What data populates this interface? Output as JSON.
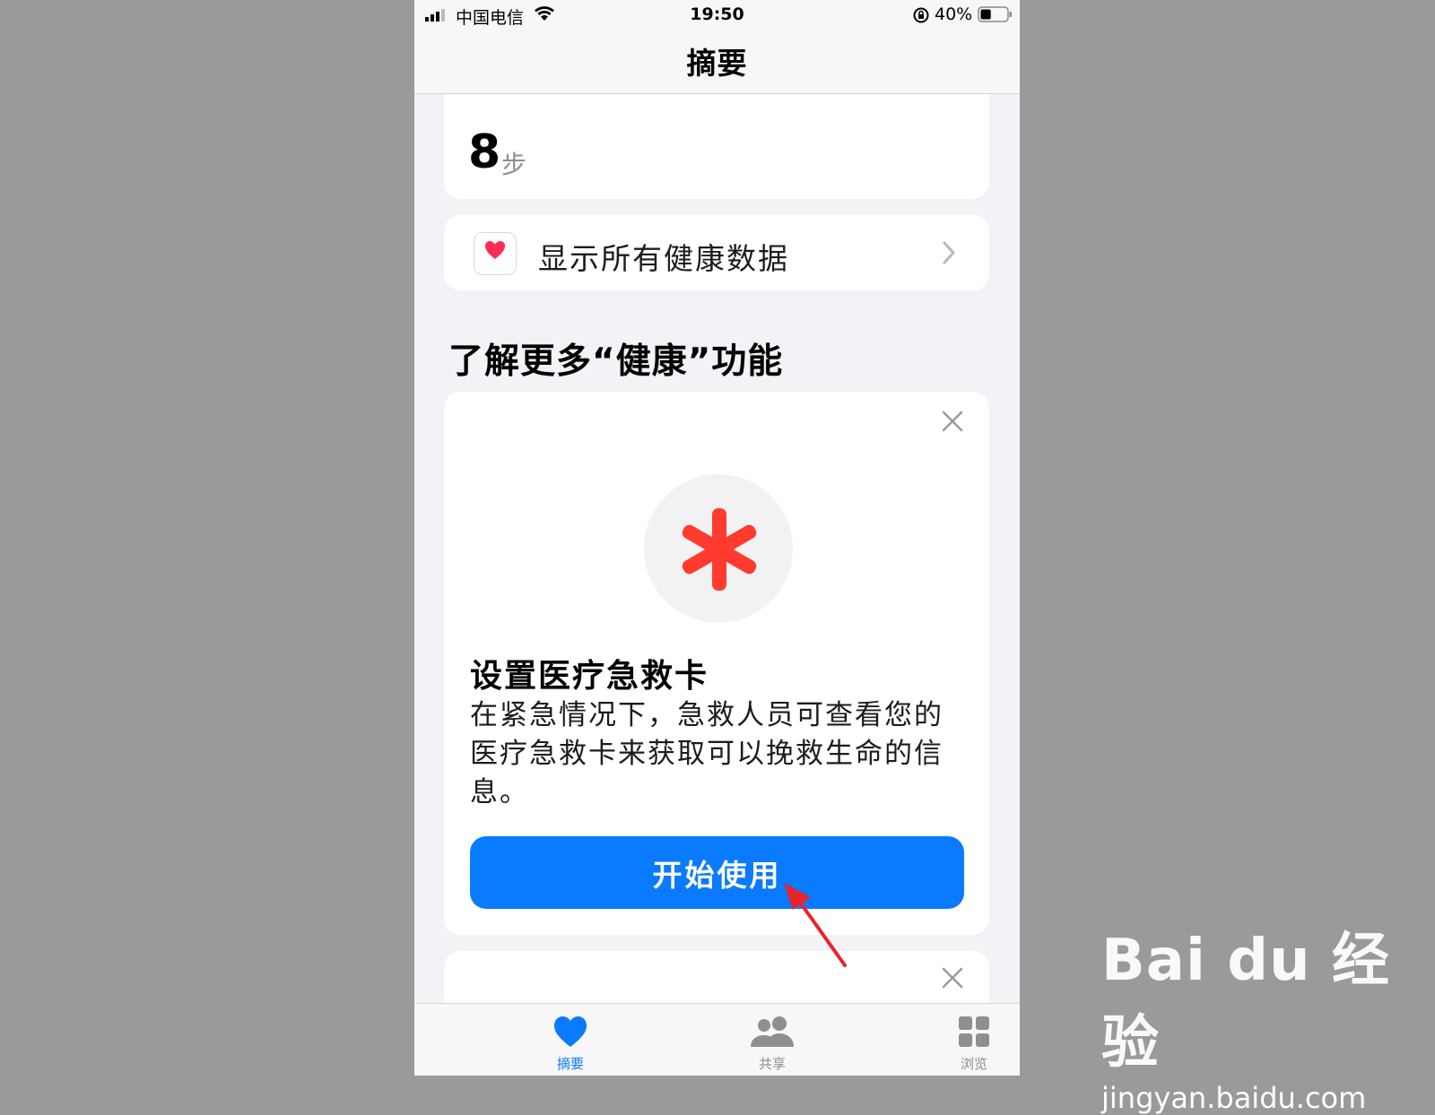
{
  "status_bar": {
    "carrier": "中国电信",
    "time": "19:50",
    "battery_percent": "40%",
    "battery_level": 0.4
  },
  "nav": {
    "title": "摘要"
  },
  "steps_card": {
    "value": "8",
    "unit": "步"
  },
  "all_data_row": {
    "label": "显示所有健康数据",
    "icon": "heart-icon"
  },
  "section": {
    "title": "了解更多“健康”功能"
  },
  "medical_card": {
    "icon": "asterisk-icon",
    "title": "设置医疗急救卡",
    "description": "在紧急情况下，急救人员可查看您的医疗急救卡来获取可以挽救生命的信息。",
    "button_label": "开始使用"
  },
  "tabbar": {
    "items": [
      {
        "label": "摘要",
        "icon": "heart-icon",
        "selected": true
      },
      {
        "label": "共享",
        "icon": "people-icon",
        "selected": false
      },
      {
        "label": "浏览",
        "icon": "grid-icon",
        "selected": false
      }
    ]
  },
  "watermark": {
    "brand": "Bai du 经验",
    "url": "jingyan.baidu.com"
  },
  "colors": {
    "accent": "#0a7aff",
    "medical_red": "#ff3b30",
    "heart_pink": "#ff2d55"
  }
}
